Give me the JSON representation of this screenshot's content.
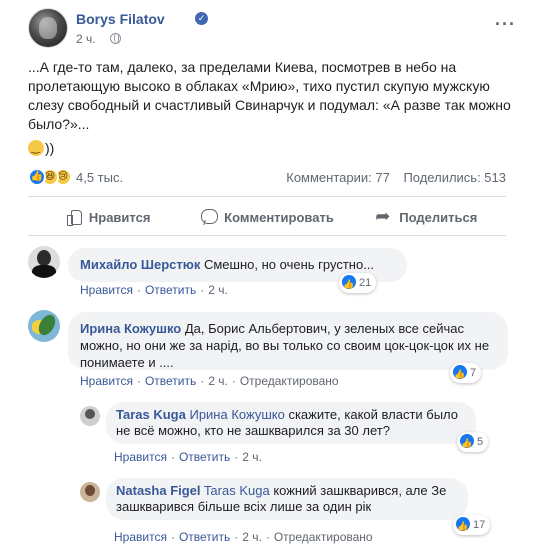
{
  "post": {
    "author": "Borys Filatov",
    "time": "2 ч.",
    "text": "...А где-то там, далеко, за пределами Киева, посмотрев в небо на пролетающую высоко в облаках «Мрию», тихо пустил скупую мужскую слезу свободный и счастливый Свинарчук и подумал: «А разве так можно было?»...",
    "emoji_suffix": "))",
    "reaction_count": "4,5 тыс.",
    "comments_count": "Комментарии: 77",
    "shares_count": "Поделились: 513"
  },
  "actions": {
    "like": "Нравится",
    "comment": "Комментировать",
    "share": "Поделиться"
  },
  "comments": [
    {
      "name": "Михайло Шерстюк",
      "text": "Смешно, но очень грустно...",
      "like_label": "Нравится",
      "reply_label": "Ответить",
      "time": "2 ч.",
      "likes": "21"
    },
    {
      "name": "Ирина Кожушко",
      "text": "Да, Борис Альбертович, у зеленых все сейчас можно, но они же за нарід, во вы только со своим цок-цок-цок их не понимаете и ....",
      "like_label": "Нравится",
      "reply_label": "Ответить",
      "time": "2 ч.",
      "edited": "Отредактировано",
      "likes": "7"
    },
    {
      "name": "Taras Kuga",
      "mention": "Ирина Кожушко",
      "text": "скажите, какой власти было не всё можно, кто не зашкварился за 30 лет?",
      "like_label": "Нравится",
      "reply_label": "Ответить",
      "time": "2 ч.",
      "likes": "5"
    },
    {
      "name": "Natasha Figel",
      "mention": "Taras Kuga",
      "text": "кожний зашкварився, але Зе зашкварився більше всіх лише за один рік",
      "like_label": "Нравится",
      "reply_label": "Ответить",
      "time": "2 ч.",
      "edited": "Отредактировано",
      "likes": "17"
    }
  ],
  "icons": {
    "verified": "verified-badge-icon",
    "globe": "globe-icon",
    "more": "more-options-icon",
    "like": "thumbs-up-icon",
    "comment": "comment-bubble-icon",
    "share": "share-arrow-icon"
  },
  "colors": {
    "link": "#385898",
    "like_blue": "#1877f2",
    "bubble_bg": "#f2f3f5",
    "muted": "#606770"
  }
}
